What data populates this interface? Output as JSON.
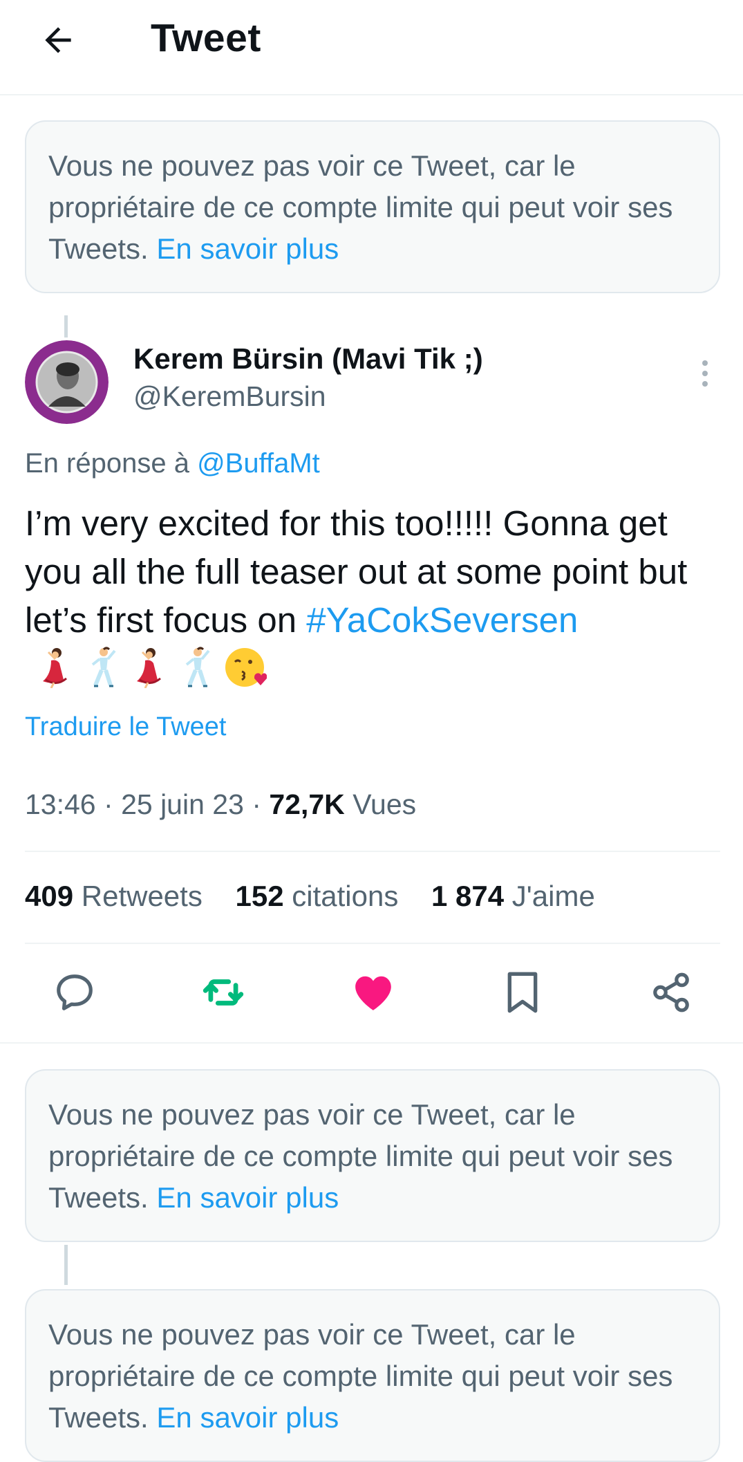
{
  "header": {
    "title": "Tweet",
    "back_icon": "arrow-left-icon"
  },
  "notices": [
    {
      "text": "Vous ne pouvez pas voir ce Tweet, car le propriétaire de ce compte limite qui peut voir ses Tweets.",
      "link": "En savoir plus"
    },
    {
      "text": "Vous ne pouvez pas voir ce Tweet, car le propriétaire de ce compte limite qui peut voir ses Tweets.",
      "link": "En savoir plus"
    },
    {
      "text": "Vous ne pouvez pas voir ce Tweet, car le propriétaire de ce compte limite qui peut voir ses Tweets.",
      "link": "En savoir plus"
    }
  ],
  "tweet": {
    "author_name": "Kerem Bürsin (Mavi Tik ;)",
    "author_handle": "@KeremBursin",
    "reply_prefix": "En réponse à",
    "reply_to": "@BuffaMt",
    "text": "I’m very excited for this too!!!!! Gonna get you all the full teaser out at some point but let’s first focus on",
    "hashtag": "#YaCokSeversen",
    "emojis": [
      "dancing-woman-emoji",
      "dancing-man-emoji",
      "dancing-woman-emoji",
      "dancing-man-emoji",
      "kissing-face-emoji"
    ],
    "translate": "Traduire le Tweet",
    "time": "13:46",
    "date": "25 juin 23",
    "views_count": "72,7K",
    "views_label": "Vues",
    "separator": "·"
  },
  "stats": {
    "retweets_count": "409",
    "retweets_label": "Retweets",
    "quotes_count": "152",
    "quotes_label": "citations",
    "likes_count": "1 874",
    "likes_label": "J'aime"
  },
  "actions": [
    "reply-icon",
    "retweet-icon",
    "like-icon",
    "bookmark-icon",
    "share-icon"
  ],
  "colors": {
    "accent": "#1d9bf0",
    "retweet": "#00ba7c",
    "like": "#f91880",
    "muted": "#536471",
    "text": "#0f1419"
  }
}
